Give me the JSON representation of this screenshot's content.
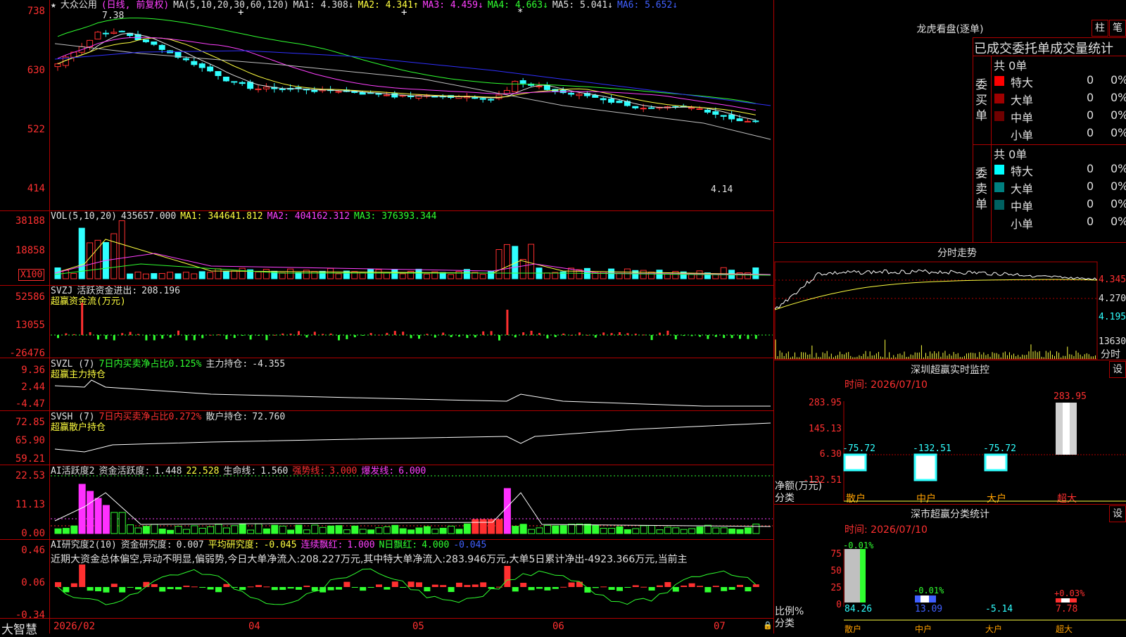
{
  "main": {
    "stock_name": "大众公用",
    "period": "(日线, 前复权)",
    "ma_params": "MA(5,10,20,30,60,120)",
    "ma": [
      {
        "label": "MA1:",
        "value": "4.308",
        "arrow": "↓",
        "color": "#e0e0e0"
      },
      {
        "label": "MA2:",
        "value": "4.341",
        "arrow": "↑",
        "color": "#ffff40"
      },
      {
        "label": "MA3:",
        "value": "4.459",
        "arrow": "↓",
        "color": "#ff40ff"
      },
      {
        "label": "MA4:",
        "value": "4.663",
        "arrow": "↓",
        "color": "#30ff30"
      },
      {
        "label": "MA5:",
        "value": "5.041",
        "arrow": "↓",
        "color": "#e0e0e0"
      },
      {
        "label": "MA6:",
        "value": "5.652",
        "arrow": "↓",
        "color": "#4060ff"
      }
    ],
    "y_labels": [
      "738",
      "630",
      "522",
      "414"
    ],
    "high_marker": "7.38",
    "low_marker": "4.14",
    "star": "★"
  },
  "vol": {
    "header": "VOL(5,10,20)",
    "value": "435657.000",
    "ma1": "344641.812",
    "ma2": "404162.312",
    "ma3": "376393.344",
    "y_labels": [
      "38188",
      "18858"
    ],
    "unit": "X100"
  },
  "svzj": {
    "name": "SVZJ",
    "label": "活跃资金进出:",
    "value": "208.196",
    "subtitle": "超赢资金流(万元)",
    "y_labels": [
      "52586",
      "13055",
      "-26476"
    ]
  },
  "svzl": {
    "name": "SVZL (7)",
    "label": "7日内买卖净占比0.125%",
    "label2": "主力持仓:",
    "value": "-4.355",
    "subtitle": "超赢主力持仓",
    "y_labels": [
      "9.36",
      "2.44",
      "-4.47"
    ]
  },
  "svsh": {
    "name": "SVSH (7)",
    "label": "7日内买卖净占比0.272%",
    "label2": "散户持仓:",
    "value": "72.760",
    "subtitle": "超赢散户持仓",
    "y_labels": [
      "72.85",
      "65.90",
      "59.21"
    ]
  },
  "ai1": {
    "name": "AI活跃度2",
    "label": "资金活跃度:",
    "value": "1.448",
    "v2": "22.528",
    "label3": "生命线:",
    "v3": "1.560",
    "label4": "强势线:",
    "v4": "3.000",
    "label5": "爆发线:",
    "v5": "6.000",
    "y_labels": [
      "22.53",
      "11.13",
      "0.00"
    ]
  },
  "ai2": {
    "name": "AI研究度2(10)",
    "label": "资金研究度:",
    "value": "0.007",
    "label2": "平均研究度:",
    "v2": "-0.045",
    "label3": "连续飘红:",
    "v3": "1.000",
    "label4": "N日飘红:",
    "v4": "4.000",
    "v5": "-0.045",
    "comment": "近期大资金总体偏空,异动不明显,偏弱势,今日大单净流入:208.227万元,其中特大单净流入:283.946万元,大单5日累计净出-4923.366万元,当前主",
    "y_labels": [
      "0.46",
      "0.06",
      "-0.34"
    ]
  },
  "xaxis": {
    "brand": "大智慧",
    "labels": [
      "2026/02",
      "04",
      "05",
      "06",
      "07"
    ]
  },
  "dragon": {
    "title": "龙虎看盘(逐单)",
    "btn1": "柱",
    "btn2": "笔",
    "tabs": "已成交委托单成交量统计",
    "buy": {
      "side": "委买单",
      "total": "共 0单",
      "rows": [
        {
          "name": "特大",
          "count": "0",
          "pct": "0%",
          "color": "#ff0000"
        },
        {
          "name": "大单",
          "count": "0",
          "pct": "0%",
          "color": "#a00000"
        },
        {
          "name": "中单",
          "count": "0",
          "pct": "0%",
          "color": "#700000"
        },
        {
          "name": "小单",
          "count": "0",
          "pct": "0%",
          "color": ""
        }
      ]
    },
    "sell": {
      "side": "委卖单",
      "total": "共 0单",
      "rows": [
        {
          "name": "特大",
          "count": "0",
          "pct": "0%",
          "color": "#00ffff"
        },
        {
          "name": "大单",
          "count": "0",
          "pct": "0%",
          "color": "#008080"
        },
        {
          "name": "中单",
          "count": "0",
          "pct": "0%",
          "color": "#006060"
        },
        {
          "name": "小单",
          "count": "0",
          "pct": "0%",
          "color": ""
        }
      ]
    }
  },
  "intraday": {
    "title": "分时走势",
    "y_labels": [
      "4.345",
      "4.270",
      "4.195"
    ],
    "vol_label": "13630",
    "footer": "分时"
  },
  "monitor": {
    "title": "深圳超赢实时监控",
    "btn": "设",
    "time": "时间: 2026/07/10",
    "y_labels": [
      "283.95",
      "145.13",
      "6.30",
      "-132.51"
    ],
    "axis_label": "净额(万元)",
    "axis_label2": "分类",
    "bars": [
      {
        "cat": "散户",
        "value": "-75.72"
      },
      {
        "cat": "中户",
        "value": "-132.51"
      },
      {
        "cat": "大户",
        "value": "-75.72"
      },
      {
        "cat": "超大",
        "value": "283.95"
      }
    ]
  },
  "classify": {
    "title": "深市超赢分类统计",
    "btn": "设",
    "time": "时间: 2026/07/10",
    "y_labels": [
      "75",
      "50",
      "25",
      "0"
    ],
    "axis_label": "比例%",
    "axis_label2": "分类",
    "top_labels": [
      "-0.01%",
      "-0.01%",
      "",
      "+0.03%"
    ],
    "bottom_values": [
      "84.26",
      "13.09",
      "-5.14",
      "7.78"
    ],
    "cats": [
      "散户",
      "中户",
      "大户",
      "超大"
    ]
  }
}
